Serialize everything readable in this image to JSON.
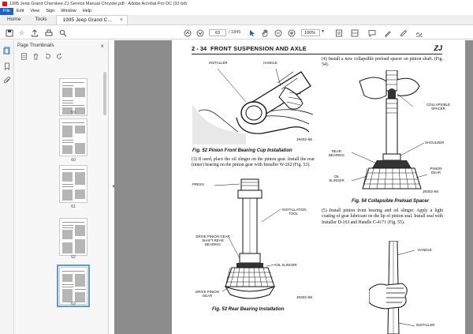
{
  "window": {
    "title": "1995 Jeep Grand Cherokee ZJ Service Manual Chrysler.pdf - Adobe Acrobat Pro DC (32-bit)"
  },
  "menu": [
    "File",
    "Edit",
    "View",
    "Sign",
    "Window",
    "Help"
  ],
  "tabs": {
    "home": "Home",
    "tools": "Tools",
    "document": "1995 Jeep Grand C..."
  },
  "toolbar": {
    "current_page": "63",
    "page_total": "/ 1845",
    "zoom": "100%"
  },
  "thumbnails": {
    "title": "Page Thumbnails",
    "pages": [
      "59",
      "60",
      "61",
      "62",
      "63"
    ],
    "selected": "63"
  },
  "document": {
    "page_number": "2 - 34",
    "section_title": "FRONT SUSPENSION AND AXLE",
    "model_code": "ZJ",
    "fig52": {
      "labels": {
        "installer": "INSTALLER",
        "handle": "HANDLE"
      },
      "id": "J9402-65",
      "caption": "Fig. 52 Pinion Front Bearing Cup Installation"
    },
    "step3_text": "(3) If used, place the oil slinger on the pinion gear. Install the rear (inner) bearing on the pinion gear with Installer W-262 (Fig. 53).",
    "fig53": {
      "labels": {
        "press": "PRESS",
        "installation_tool": "INSTALLATION TOOL",
        "drive_pinion_shaft": "DRIVE PINION GEAR SHAFT REAR BEARING",
        "oil_slinger": "OIL SLINGER",
        "drive_pinion_gear": "DRIVE PINION GEAR"
      },
      "id": "J9302-68",
      "caption": "Fig. 53 Rear Bearing Installation"
    },
    "step4_text": "(4) Install a new collapsible preload spacer on pinion shaft. (Fig. 54).",
    "fig54": {
      "labels": {
        "collapsible_spacer": "COLLAPSIBLE SPACER",
        "shoulder": "SHOULDER",
        "rear_bearing": "REAR BEARING",
        "pinion_gear": "PINION GEAR",
        "oil_slinger": "OIL SLINGER"
      },
      "id": "J9302-66",
      "caption": "Fig. 54 Collapsible Preload Spacer"
    },
    "step5_text": "(5) Install pinion front bearing and oil slinger. Apply a light coating of gear lubricant on the lip of pinion seal. Install seal with Installer D-163 and Handle C-4171 (Fig. 55).",
    "fig55": {
      "labels": {
        "handle": "HANDLE",
        "installer": "INSTALLER"
      }
    }
  }
}
